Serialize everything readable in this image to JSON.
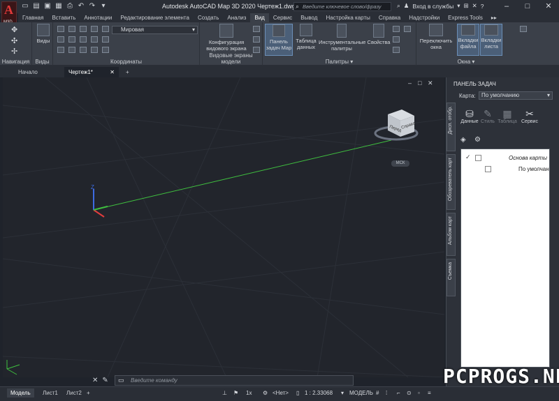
{
  "window": {
    "title": "Autodesk AutoCAD Map 3D 2020   Чертеж1.dwg",
    "logo_sub": "M3D",
    "search_placeholder": "Введите ключевое слово/фразу",
    "signin": "Вход в службы"
  },
  "ribbon_tabs": [
    "Главная",
    "Вставить",
    "Аннотации",
    "Редактирование элемента",
    "Создать",
    "Анализ",
    "Вид",
    "Сервис",
    "Вывод",
    "Настройка карты",
    "Справка",
    "Надстройки",
    "Express Tools"
  ],
  "active_ribbon_tab": "Вид",
  "ribbon": {
    "navigation": {
      "title": "Навигация"
    },
    "views": {
      "title": "Виды",
      "button": "Виды"
    },
    "coordinates": {
      "title": "Координаты",
      "ucs_value": "Мировая"
    },
    "viewports": {
      "title": "Видовые экраны модели",
      "button_line1": "Конфигурация",
      "button_line2": "видового экрана"
    },
    "palettes": {
      "title": "Палитры",
      "buttons": [
        {
          "l1": "Панель",
          "l2": "задач Map"
        },
        {
          "l1": "Таблица",
          "l2": "данных"
        },
        {
          "l1": "Инструментальные",
          "l2": "палитры"
        },
        {
          "l1": "Свойства",
          "l2": ""
        }
      ]
    },
    "windows": {
      "title": "Окна",
      "buttons": [
        {
          "l1": "Переключить",
          "l2": "окна"
        },
        {
          "l1": "Вкладки",
          "l2": "файла"
        },
        {
          "l1": "Вкладки",
          "l2": "листа"
        }
      ]
    }
  },
  "document_tabs": [
    {
      "label": "Начало"
    },
    {
      "label": "Чертеж1*"
    }
  ],
  "viewcube": {
    "face_left": "Перед",
    "face_right": "Справа",
    "wcs_label": "МСК"
  },
  "command_line": {
    "placeholder": "Введите команду"
  },
  "status": {
    "layout_tabs": [
      "Модель",
      "Лист1",
      "Лист2"
    ],
    "scale": "1x",
    "crs": "<Нет>",
    "zoom": "1 : 2.33068",
    "space": "МОДЕЛЬ"
  },
  "task_pane": {
    "title": "ПАНЕЛЬ ЗАДАЧ",
    "map_label": "Карта:",
    "map_value": "По умолчанию",
    "vertical_tabs": [
      "Дисп. отобр.",
      "Обозреватель карт",
      "Альбом карт",
      "Съемка"
    ],
    "tools": [
      {
        "label": "Данные",
        "icon": "database-icon",
        "enabled": true
      },
      {
        "label": "Стиль",
        "icon": "brush-icon",
        "enabled": false
      },
      {
        "label": "Таблица",
        "icon": "table-icon",
        "enabled": false
      },
      {
        "label": "Сервис",
        "icon": "tools-icon",
        "enabled": true
      }
    ],
    "layers": [
      {
        "label": "Основа карты",
        "checked": true
      },
      {
        "label": "По умолчан",
        "checked": false
      }
    ]
  },
  "watermark": "PCPROGS.NET",
  "colors": {
    "background": "#22252c",
    "ribbon": "#3b4049",
    "accent": "#4b5f78",
    "x_axis": "#e23d3d",
    "y_axis": "#3fbf3f",
    "z_axis": "#3d6be2"
  }
}
